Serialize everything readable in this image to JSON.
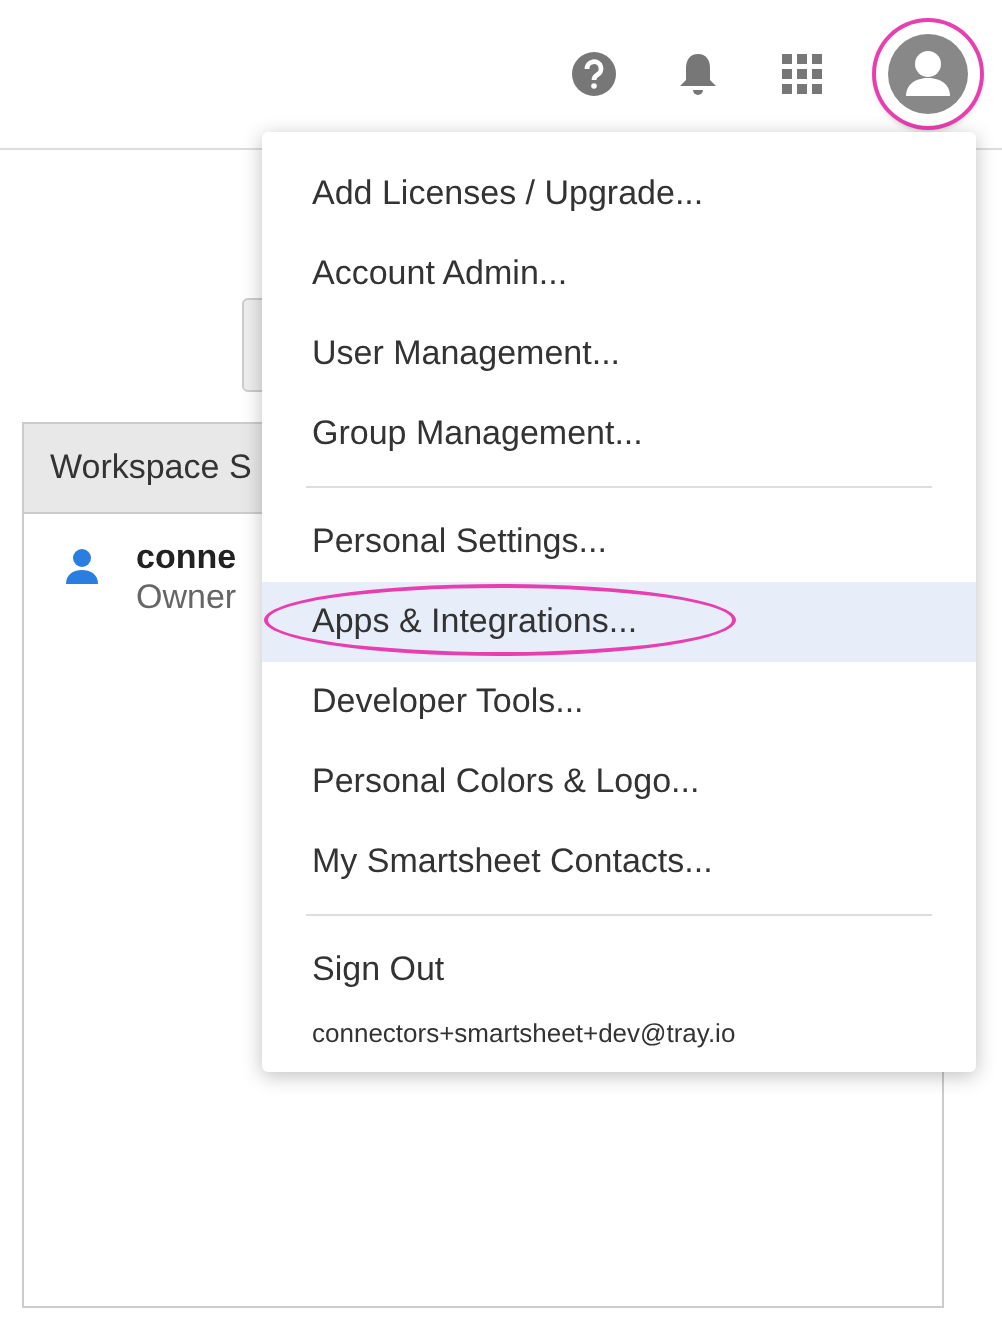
{
  "header": {
    "avatar": {
      "circled": true
    }
  },
  "panel": {
    "header": "Workspace S",
    "rows": [
      {
        "name": "conne",
        "role": "Owner"
      }
    ]
  },
  "menu": {
    "groups": [
      {
        "items": [
          {
            "label": "Add Licenses / Upgrade...",
            "selected": false,
            "circled": false
          },
          {
            "label": "Account Admin...",
            "selected": false,
            "circled": false
          },
          {
            "label": "User Management...",
            "selected": false,
            "circled": false
          },
          {
            "label": "Group Management...",
            "selected": false,
            "circled": false
          }
        ]
      },
      {
        "items": [
          {
            "label": "Personal Settings...",
            "selected": false,
            "circled": false
          },
          {
            "label": "Apps & Integrations...",
            "selected": true,
            "circled": true
          },
          {
            "label": "Developer Tools...",
            "selected": false,
            "circled": false
          },
          {
            "label": "Personal Colors & Logo...",
            "selected": false,
            "circled": false
          },
          {
            "label": "My Smartsheet Contacts...",
            "selected": false,
            "circled": false
          }
        ]
      }
    ],
    "sign_out": {
      "label": "Sign Out",
      "email": "connectors+smartsheet+dev@tray.io"
    }
  }
}
